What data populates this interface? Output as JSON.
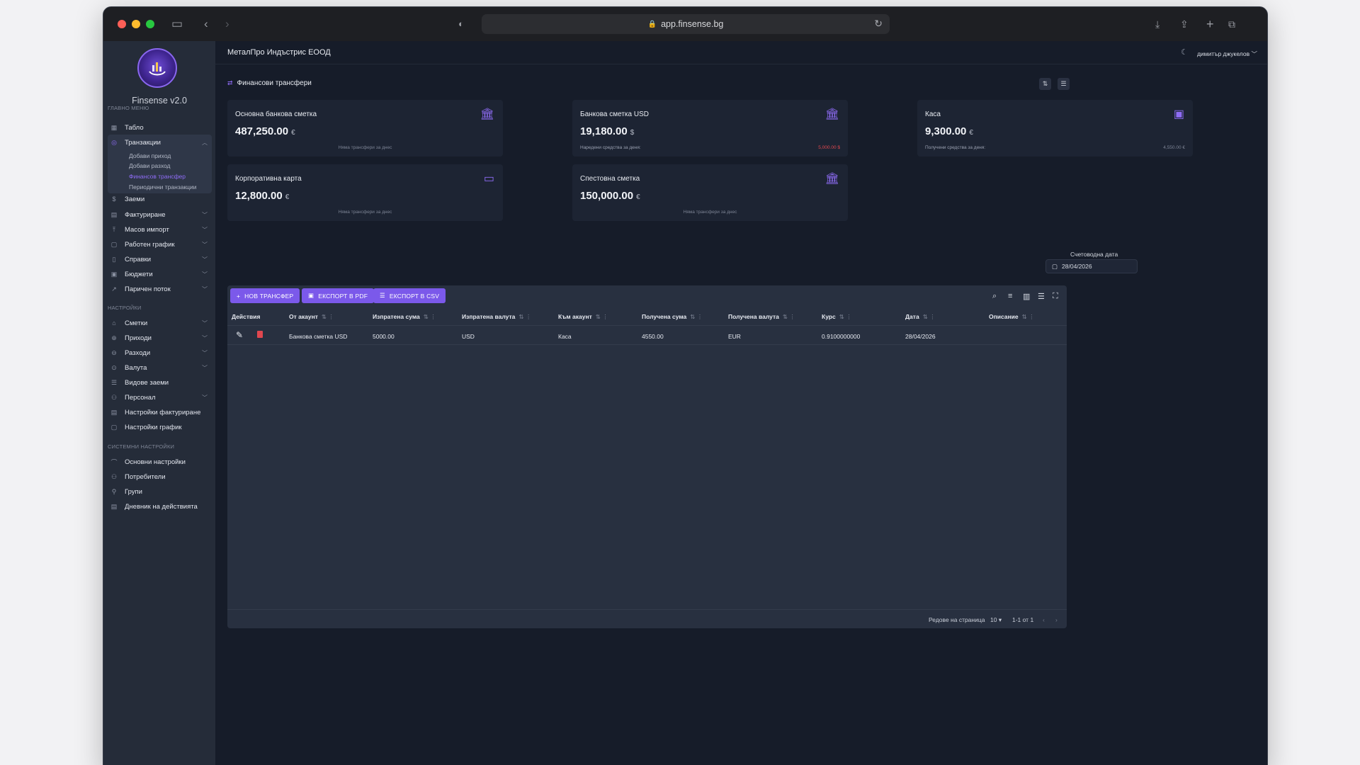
{
  "browser": {
    "url": "app.finsense.bg"
  },
  "app": {
    "name": "Finsense v2.0",
    "company": "МеталПро Индъстрис ЕООД",
    "user": "димитър джукелов"
  },
  "sidebar": {
    "sections": {
      "main": "ГЛАВНО МЕНЮ",
      "settings": "НАСТРОЙКИ",
      "system": "СИСТЕМНИ НАСТРОЙКИ"
    },
    "items": [
      {
        "label": "Табло"
      },
      {
        "label": "Транзакции"
      },
      {
        "label": "Заеми"
      },
      {
        "label": "Фактуриране"
      },
      {
        "label": "Масов импорт"
      },
      {
        "label": "Работен график"
      },
      {
        "label": "Справки"
      },
      {
        "label": "Бюджети"
      },
      {
        "label": "Паричен поток"
      },
      {
        "label": "Сметки"
      },
      {
        "label": "Приходи"
      },
      {
        "label": "Разходи"
      },
      {
        "label": "Валута"
      },
      {
        "label": "Видове заеми"
      },
      {
        "label": "Персонал"
      },
      {
        "label": "Настройки фактуриране"
      },
      {
        "label": "Настройки график"
      },
      {
        "label": "Основни настройки"
      },
      {
        "label": "Потребители"
      },
      {
        "label": "Групи"
      },
      {
        "label": "Дневник на действията"
      }
    ],
    "subitems": [
      {
        "label": "Добави приход"
      },
      {
        "label": "Добави разход"
      },
      {
        "label": "Финансов трансфер"
      },
      {
        "label": "Периодични транзакции"
      }
    ]
  },
  "page": {
    "title": "Финансови трансфери"
  },
  "accounts": [
    {
      "name": "Основна банкова сметка",
      "amount": "487,250.00",
      "currency": "€",
      "note": "Няма трансфери за днес"
    },
    {
      "name": "Банкова сметка USD",
      "amount": "19,180.00",
      "currency": "$",
      "note_left": "Наредени средства за деня:",
      "note_right": "5,000.00 $"
    },
    {
      "name": "Каса",
      "amount": "9,300.00",
      "currency": "€",
      "note_left": "Получени средства за деня:",
      "note_right": "4,550.00 €"
    },
    {
      "name": "Корпоративна карта",
      "amount": "12,800.00",
      "currency": "€",
      "note": "Няма трансфери за днес"
    },
    {
      "name": "Спестовна сметка",
      "amount": "150,000.00",
      "currency": "€",
      "note": "Няма трансфери за днес"
    }
  ],
  "colors": {
    "accent": "#7b59ea",
    "sent": "#e0474f",
    "received": "#7c8394"
  },
  "accounting_date": {
    "label": "Счетоводна дата",
    "value": "28/04/2026"
  },
  "toolbar": {
    "new_transfer": "НОВ ТРАНСФЕР",
    "export_pdf": "ЕКСПОРТ В PDF",
    "export_csv": "ЕКСПОРТ В CSV"
  },
  "table": {
    "columns": [
      "Действия",
      "От акаунт",
      "Изпратена сума",
      "Изпратена валута",
      "Към акаунт",
      "Получена сума",
      "Получена валута",
      "Курс",
      "Дата",
      "Описание"
    ],
    "rows": [
      {
        "from": "Банкова сметка USD",
        "sent_amount": "5000.00",
        "sent_currency": "USD",
        "to": "Каса",
        "received_amount": "4550.00",
        "received_currency": "EUR",
        "rate": "0.9100000000",
        "date": "28/04/2026",
        "description": ""
      }
    ]
  },
  "pagination": {
    "rows_label": "Редове на страница",
    "rows_value": "10",
    "range": "1-1 от 1"
  }
}
